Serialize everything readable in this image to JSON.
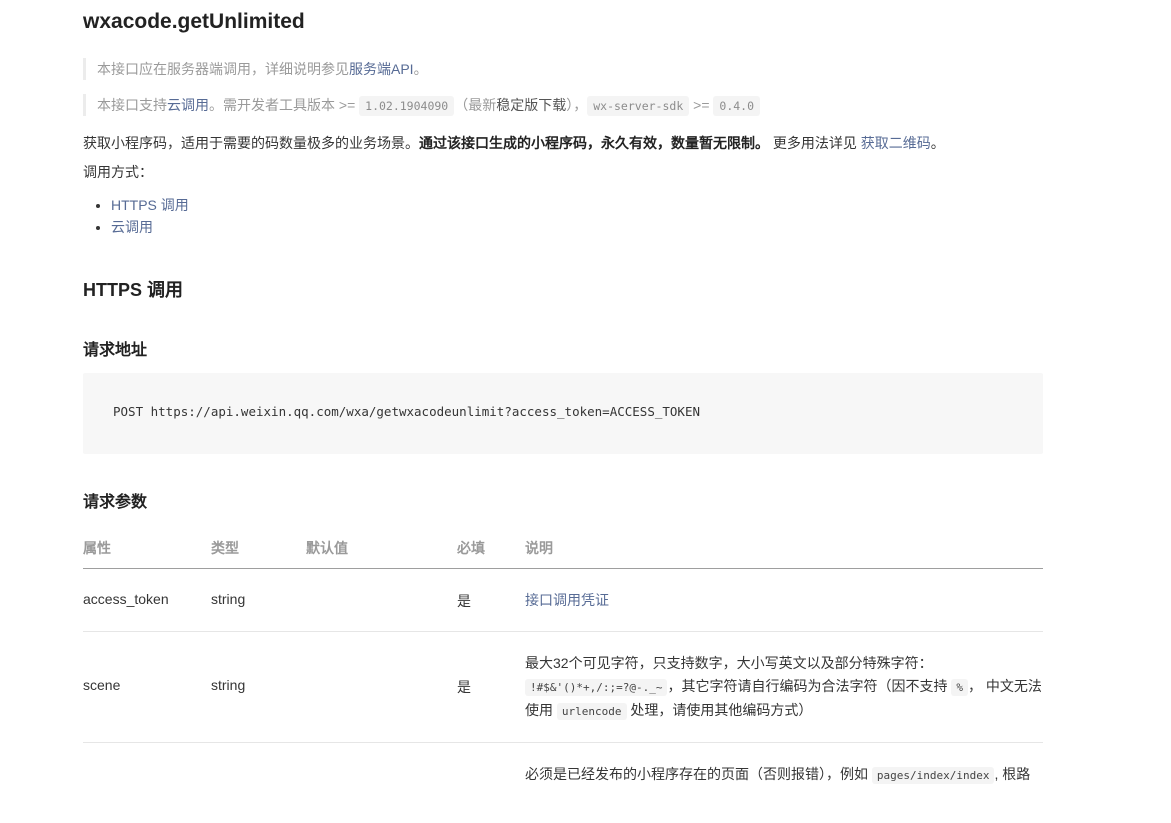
{
  "title": "wxacode.getUnlimited",
  "notes": {
    "server": {
      "prefix": "本接口应在服务器端调用，详细说明参见",
      "link": "服务端API",
      "suffix": "。"
    },
    "cloud": {
      "prefix": "本接口支持",
      "link": "云调用",
      "mid1": "。需开发者工具版本 >= ",
      "version": "1.02.1904090",
      "mid2": "（最新",
      "download": "稳定版下载",
      "mid3": "），",
      "sdk": "wx-server-sdk",
      "mid4": " >= ",
      "sdk_version": "0.4.0"
    }
  },
  "description": {
    "part1": "获取小程序码，适用于需要的码数量极多的业务场景。",
    "bold": "通过该接口生成的小程序码，永久有效，数量暂无限制。",
    "part2": " 更多用法详见 ",
    "link": "获取二维码",
    "end": "。"
  },
  "usage": {
    "title": "调用方式：",
    "items": [
      "HTTPS 调用",
      "云调用"
    ]
  },
  "https_section": {
    "title": "HTTPS 调用",
    "url_title": "请求地址",
    "url": "POST https://api.weixin.qq.com/wxa/getwxacodeunlimit?access_token=ACCESS_TOKEN",
    "params_title": "请求参数"
  },
  "table": {
    "headers": {
      "name": "属性",
      "type": "类型",
      "default": "默认值",
      "required": "必填",
      "desc": "说明"
    },
    "rows": [
      {
        "name": "access_token",
        "type": "string",
        "default": "",
        "required": "是",
        "desc_link": "接口调用凭证"
      },
      {
        "name": "scene",
        "type": "string",
        "default": "",
        "required": "是",
        "desc_line1": "最大32个可见字符，只支持数字，大小写英文以及部分特殊字符：",
        "desc_code1": "!#$&'()*+,/:;=?@-._~",
        "desc_mid": "，其它字符请自行编码为合法字符（因不支持 ",
        "desc_code2": "%",
        "desc_mid2": "， 中文无法使用 ",
        "desc_code3": "urlencode",
        "desc_end": " 处理，请使用其他编码方式）"
      },
      {
        "name": "",
        "type": "",
        "default": "",
        "required": "",
        "desc_line1": "必须是已经发布的小程序存在的页面（否则报错），例如 ",
        "desc_code1": "pages/index/index",
        "desc_end": ", 根路"
      }
    ]
  }
}
